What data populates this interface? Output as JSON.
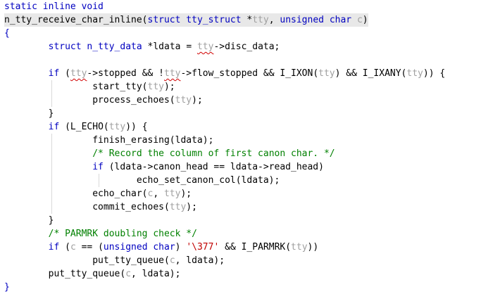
{
  "editor": {
    "language": "C",
    "colors": {
      "background": "#ffffff",
      "keyword": "#0000c0",
      "variable": "#a0a0a0",
      "comment": "#008000",
      "string": "#c00000",
      "highlight": "#e8e8e8",
      "squiggle": "#d00000"
    },
    "lines": [
      {
        "tokens": [
          {
            "t": "static inline void",
            "c": "kw"
          }
        ]
      },
      {
        "highlight": true,
        "tokens": [
          {
            "t": "n_tty_receive_char_inline",
            "c": "plain"
          },
          {
            "t": "(",
            "c": "plain"
          },
          {
            "t": "struct",
            "c": "kw"
          },
          {
            "t": " ",
            "c": "plain"
          },
          {
            "t": "tty_struct",
            "c": "kw"
          },
          {
            "t": " *",
            "c": "plain"
          },
          {
            "t": "tty",
            "c": "var"
          },
          {
            "t": ", ",
            "c": "plain"
          },
          {
            "t": "unsigned",
            "c": "kw"
          },
          {
            "t": " ",
            "c": "plain"
          },
          {
            "t": "char",
            "c": "kw"
          },
          {
            "t": " ",
            "c": "plain"
          },
          {
            "t": "c",
            "c": "var"
          },
          {
            "t": ")",
            "c": "plain"
          }
        ]
      },
      {
        "tokens": [
          {
            "t": "{",
            "c": "kw"
          }
        ]
      },
      {
        "tokens": [
          {
            "t": "        ",
            "c": "plain"
          },
          {
            "t": "struct",
            "c": "kw"
          },
          {
            "t": " ",
            "c": "plain"
          },
          {
            "t": "n_tty_data",
            "c": "kw"
          },
          {
            "t": " *ldata = ",
            "c": "plain"
          },
          {
            "t": "tty",
            "c": "var",
            "squiggle": true
          },
          {
            "t": "->disc_data;",
            "c": "plain"
          }
        ]
      },
      {
        "tokens": []
      },
      {
        "tokens": [
          {
            "t": "        ",
            "c": "plain"
          },
          {
            "t": "if",
            "c": "kw"
          },
          {
            "t": " (",
            "c": "plain"
          },
          {
            "t": "tty",
            "c": "var",
            "squiggle": true
          },
          {
            "t": "->stopped && !",
            "c": "plain"
          },
          {
            "t": "tty",
            "c": "var",
            "squiggle": true
          },
          {
            "t": "->flow_stopped && I_IXON(",
            "c": "plain"
          },
          {
            "t": "tty",
            "c": "var"
          },
          {
            "t": ") && I_IXANY(",
            "c": "plain"
          },
          {
            "t": "tty",
            "c": "var"
          },
          {
            "t": ")) {",
            "c": "plain"
          }
        ]
      },
      {
        "tokens": [
          {
            "t": "                start_tty(",
            "c": "plain"
          },
          {
            "t": "tty",
            "c": "var"
          },
          {
            "t": ");",
            "c": "plain"
          }
        ]
      },
      {
        "tokens": [
          {
            "t": "                process_echoes(",
            "c": "plain"
          },
          {
            "t": "tty",
            "c": "var"
          },
          {
            "t": ");",
            "c": "plain"
          }
        ]
      },
      {
        "tokens": [
          {
            "t": "        ",
            "c": "plain"
          },
          {
            "t": "}",
            "c": "brace"
          }
        ]
      },
      {
        "tokens": [
          {
            "t": "        ",
            "c": "plain"
          },
          {
            "t": "if",
            "c": "kw"
          },
          {
            "t": " (L_ECHO(",
            "c": "plain"
          },
          {
            "t": "tty",
            "c": "var"
          },
          {
            "t": ")) {",
            "c": "plain"
          }
        ]
      },
      {
        "tokens": [
          {
            "t": "                finish_erasing(ldata);",
            "c": "plain"
          }
        ]
      },
      {
        "tokens": [
          {
            "t": "                ",
            "c": "plain"
          },
          {
            "t": "/* Record the column of first canon char. */",
            "c": "cmt"
          }
        ]
      },
      {
        "tokens": [
          {
            "t": "                ",
            "c": "plain"
          },
          {
            "t": "if",
            "c": "kw"
          },
          {
            "t": " (ldata->canon_head == ldata->read_head)",
            "c": "plain"
          }
        ]
      },
      {
        "tokens": [
          {
            "t": "                        echo_set_canon_col(ldata);",
            "c": "plain"
          }
        ]
      },
      {
        "tokens": [
          {
            "t": "                echo_char(",
            "c": "plain"
          },
          {
            "t": "c",
            "c": "var"
          },
          {
            "t": ", ",
            "c": "plain"
          },
          {
            "t": "tty",
            "c": "var"
          },
          {
            "t": ");",
            "c": "plain"
          }
        ]
      },
      {
        "tokens": [
          {
            "t": "                commit_echoes(",
            "c": "plain"
          },
          {
            "t": "tty",
            "c": "var"
          },
          {
            "t": ");",
            "c": "plain"
          }
        ]
      },
      {
        "tokens": [
          {
            "t": "        ",
            "c": "plain"
          },
          {
            "t": "}",
            "c": "brace"
          }
        ]
      },
      {
        "tokens": [
          {
            "t": "        ",
            "c": "plain"
          },
          {
            "t": "/* PARMRK doubling check */",
            "c": "cmt"
          }
        ]
      },
      {
        "tokens": [
          {
            "t": "        ",
            "c": "plain"
          },
          {
            "t": "if",
            "c": "kw"
          },
          {
            "t": " (",
            "c": "plain"
          },
          {
            "t": "c",
            "c": "var"
          },
          {
            "t": " == (",
            "c": "plain"
          },
          {
            "t": "unsigned",
            "c": "kw"
          },
          {
            "t": " ",
            "c": "plain"
          },
          {
            "t": "char",
            "c": "kw"
          },
          {
            "t": ") ",
            "c": "plain"
          },
          {
            "t": "'\\377'",
            "c": "str"
          },
          {
            "t": " && I_PARMRK(",
            "c": "plain"
          },
          {
            "t": "tty",
            "c": "var"
          },
          {
            "t": "))",
            "c": "plain"
          }
        ]
      },
      {
        "tokens": [
          {
            "t": "                put_tty_queue(",
            "c": "plain"
          },
          {
            "t": "c",
            "c": "var"
          },
          {
            "t": ", ldata);",
            "c": "plain"
          }
        ]
      },
      {
        "tokens": [
          {
            "t": "        put_tty_queue(",
            "c": "plain"
          },
          {
            "t": "c",
            "c": "var"
          },
          {
            "t": ", ldata);",
            "c": "plain"
          }
        ]
      },
      {
        "tokens": [
          {
            "t": "}",
            "c": "kw"
          }
        ]
      }
    ]
  }
}
